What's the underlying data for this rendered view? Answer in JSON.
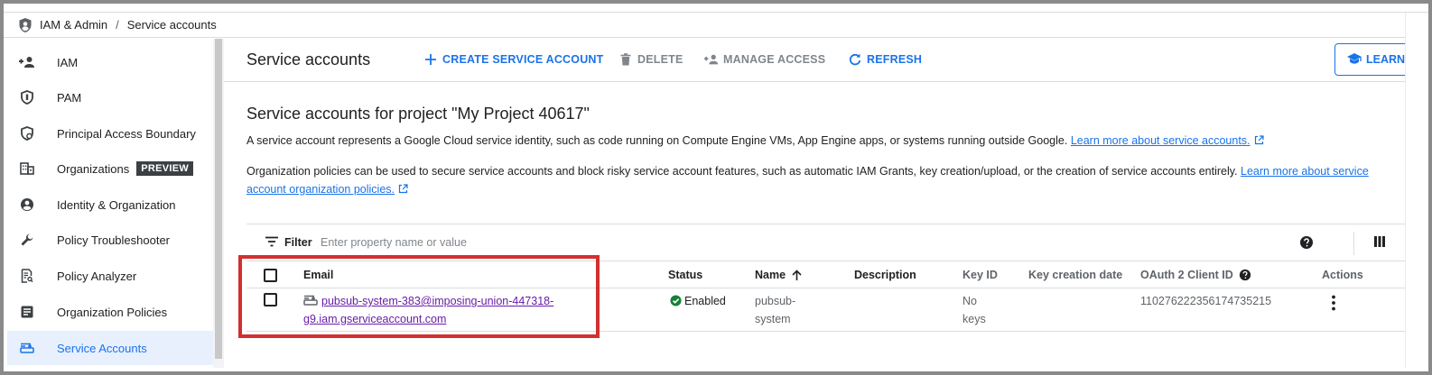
{
  "breadcrumb": {
    "root": "IAM & Admin",
    "separator": "/",
    "current": "Service accounts"
  },
  "sidebar": {
    "items": [
      {
        "label": "IAM",
        "icon": "person-add-icon"
      },
      {
        "label": "PAM",
        "icon": "shield-icon"
      },
      {
        "label": "Principal Access Boundary",
        "icon": "boundary-shield-icon"
      },
      {
        "label": "Organizations",
        "icon": "organization-icon",
        "badge": "PREVIEW"
      },
      {
        "label": "Identity & Organization",
        "icon": "account-circle-icon"
      },
      {
        "label": "Policy Troubleshooter",
        "icon": "wrench-icon"
      },
      {
        "label": "Policy Analyzer",
        "icon": "policy-analyzer-icon"
      },
      {
        "label": "Organization Policies",
        "icon": "list-icon"
      },
      {
        "label": "Service Accounts",
        "icon": "service-account-icon",
        "active": true
      }
    ]
  },
  "toolbar": {
    "title": "Service accounts",
    "create_label": "CREATE SERVICE ACCOUNT",
    "delete_label": "DELETE",
    "manage_label": "MANAGE ACCESS",
    "refresh_label": "REFRESH",
    "learn_label": "LEARN"
  },
  "content": {
    "heading": "Service accounts for project \"My Project 40617\"",
    "desc1": "A service account represents a Google Cloud service identity, such as code running on Compute Engine VMs, App Engine apps, or systems running outside Google.",
    "desc1_link": "Learn more about service accounts.",
    "desc2": "Organization policies can be used to secure service accounts and block risky service account features, such as automatic IAM Grants, key creation/upload, or the creation of service accounts entirely.",
    "desc2_link": "Learn more about service account organization policies."
  },
  "filter": {
    "label": "Filter",
    "placeholder": "Enter property name or value"
  },
  "table": {
    "columns": {
      "email": "Email",
      "status": "Status",
      "name": "Name",
      "description": "Description",
      "key_id": "Key ID",
      "key_creation_date": "Key creation date",
      "oauth_client_id": "OAuth 2 Client ID",
      "actions": "Actions"
    },
    "rows": [
      {
        "email_line1": "pubsub-system-383@imposing-union-447318-",
        "email_line2": "g9.iam.gserviceaccount.com",
        "status": "Enabled",
        "name_line1": "pubsub-",
        "name_line2": "system",
        "description": "",
        "key_line1": "No",
        "key_line2": "keys",
        "key_creation_date": "",
        "oauth_client_id": "110276222356174735215"
      }
    ]
  },
  "colors": {
    "accent": "#1a73e8",
    "visited_link": "#681da8",
    "enabled": "#188038",
    "highlight_box": "#d32f2f"
  }
}
